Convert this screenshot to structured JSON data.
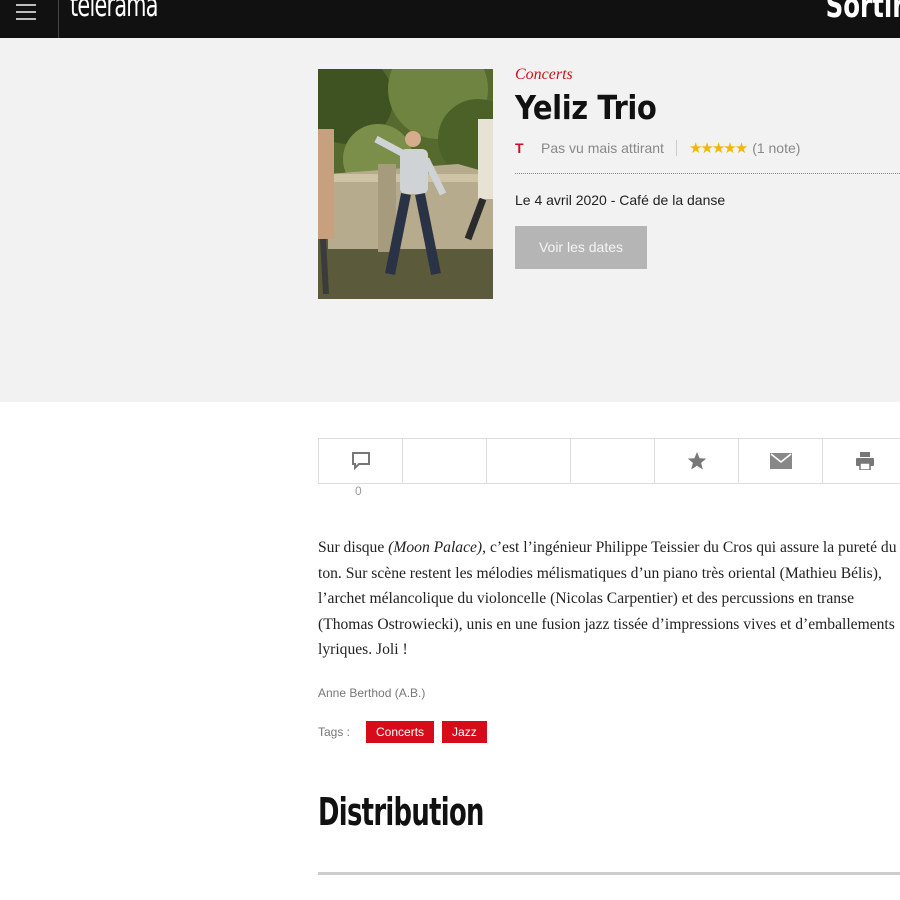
{
  "header": {
    "logo": "télérama",
    "section": "Sortir"
  },
  "hero": {
    "category": "Concerts",
    "title": "Yeliz Trio",
    "t_mark": "T",
    "critic_rating": "Pas vu mais attirant",
    "stars": "★★★★★",
    "notes": "(1 note)",
    "event_date": "Le 4 avril 2020 - Café de la danse",
    "dates_button": "Voir les dates"
  },
  "toolbar": {
    "comment_count": "0",
    "icons": [
      "comment-icon",
      "blank",
      "blank",
      "blank",
      "star-icon",
      "mail-icon",
      "print-icon"
    ]
  },
  "article": {
    "p1_a": "Sur disque ",
    "p1_em": "(Moon Palace)",
    "p1_b": ", c’est l’ingénieur Philippe Teissier du Cros qui assure la pureté du ton. Sur scène restent les mélodies mélismatiques d’un piano très oriental (Mathieu Bélis), l’archet mélancolique du violoncelle (Nicolas Carpentier) et des percussions en transe (Thomas Ostrowiecki), unis en une fusion jazz tissée d’impressions vives et d’emballements lyriques. Joli !",
    "author": "Anne Berthod (A.B.)",
    "tags_label": "Tags :",
    "tags": [
      "Concerts",
      "Jazz"
    ]
  },
  "distribution": {
    "heading": "Distribution"
  },
  "colors": {
    "accent": "#c8141e",
    "topbar": "#111111",
    "hero_bg": "#f2f2f2"
  }
}
